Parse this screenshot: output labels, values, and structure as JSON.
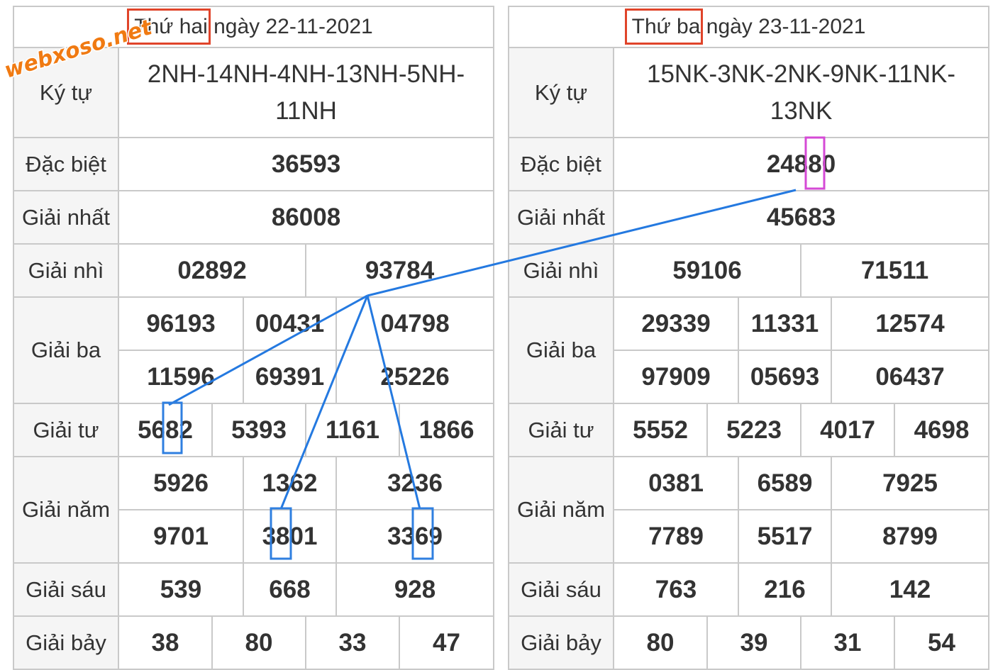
{
  "watermark": "webxoso.net",
  "left": {
    "day": "Thứ hai",
    "date_text": " ngày 22-11-2021",
    "kytu_label": "Ký tự",
    "kytu": "2NH-14NH-4NH-13NH-5NH-11NH",
    "labels": {
      "dacbiet": "Đặc biệt",
      "nhat": "Giải nhất",
      "nhi": "Giải nhì",
      "ba": "Giải ba",
      "tu": "Giải tư",
      "nam": "Giải năm",
      "sau": "Giải sáu",
      "bay": "Giải bảy"
    },
    "dacbiet": "36593",
    "nhat": "86008",
    "nhi": [
      "02892",
      "93784"
    ],
    "ba": [
      "96193",
      "00431",
      "04798",
      "11596",
      "69391",
      "25226"
    ],
    "tu": [
      "5682",
      "5393",
      "1161",
      "1866"
    ],
    "nam": [
      "5926",
      "1362",
      "3236",
      "9701",
      "3801",
      "3369"
    ],
    "sau": [
      "539",
      "668",
      "928"
    ],
    "bay": [
      "38",
      "80",
      "33",
      "47"
    ]
  },
  "right": {
    "day": "Thứ ba",
    "date_text": " ngày 23-11-2021",
    "kytu_label": "Ký tự",
    "kytu": "15NK-3NK-2NK-9NK-11NK-13NK",
    "labels": {
      "dacbiet": "Đặc biệt",
      "nhat": "Giải nhất",
      "nhi": "Giải nhì",
      "ba": "Giải ba",
      "tu": "Giải tư",
      "nam": "Giải năm",
      "sau": "Giải sáu",
      "bay": "Giải bảy"
    },
    "dacbiet": "24880",
    "nhat": "45683",
    "nhi": [
      "59106",
      "71511"
    ],
    "ba": [
      "29339",
      "11331",
      "12574",
      "97909",
      "05693",
      "06437"
    ],
    "tu": [
      "5552",
      "5223",
      "4017",
      "4698"
    ],
    "nam": [
      "0381",
      "6589",
      "7925",
      "7789",
      "5517",
      "8799"
    ],
    "sau": [
      "763",
      "216",
      "142"
    ],
    "bay": [
      "80",
      "39",
      "31",
      "54"
    ]
  },
  "colors": {
    "special_red": "#d41515",
    "day_frame": "#e0442a",
    "highlight_blue": "#2f7fe0",
    "highlight_magenta": "#d54ad6",
    "watermark_orange": "#f07a12",
    "line_blue": "#2479e0"
  }
}
